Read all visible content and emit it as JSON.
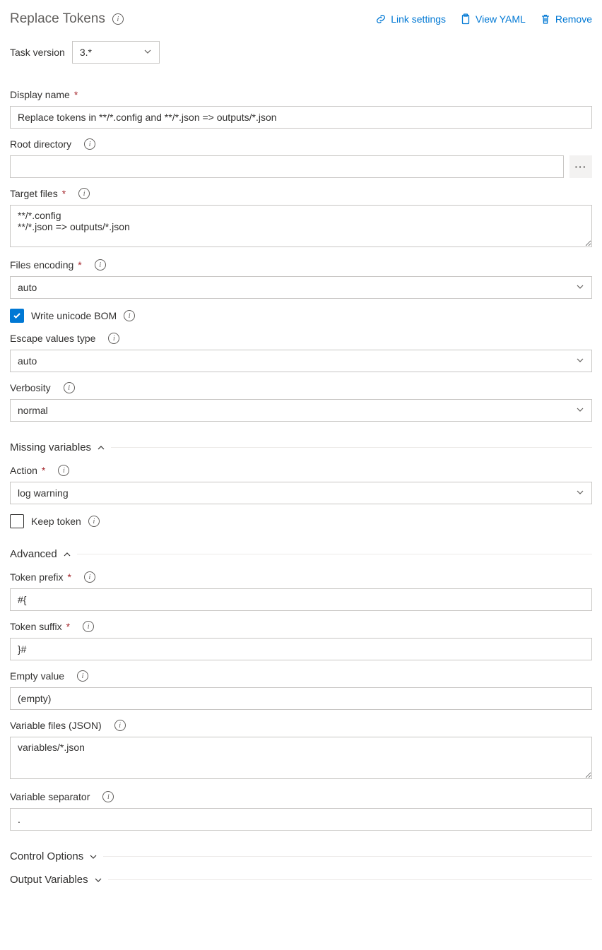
{
  "header": {
    "title": "Replace Tokens",
    "actions": {
      "linkSettings": "Link settings",
      "viewYaml": "View YAML",
      "remove": "Remove"
    }
  },
  "taskVersion": {
    "label": "Task version",
    "value": "3.*"
  },
  "displayName": {
    "label": "Display name",
    "value": "Replace tokens in **/*.config and **/*.json => outputs/*.json"
  },
  "rootDirectory": {
    "label": "Root directory",
    "value": ""
  },
  "targetFiles": {
    "label": "Target files",
    "value": "**/*.config\n**/*.json => outputs/*.json"
  },
  "filesEncoding": {
    "label": "Files encoding",
    "value": "auto"
  },
  "writeBom": {
    "label": "Write unicode BOM",
    "checked": true
  },
  "escapeValues": {
    "label": "Escape values type",
    "value": "auto"
  },
  "verbosity": {
    "label": "Verbosity",
    "value": "normal"
  },
  "sections": {
    "missingVariables": "Missing variables",
    "advanced": "Advanced",
    "controlOptions": "Control Options",
    "outputVariables": "Output Variables"
  },
  "action": {
    "label": "Action",
    "value": "log warning"
  },
  "keepToken": {
    "label": "Keep token",
    "checked": false
  },
  "tokenPrefix": {
    "label": "Token prefix",
    "value": "#{"
  },
  "tokenSuffix": {
    "label": "Token suffix",
    "value": "}#"
  },
  "emptyValue": {
    "label": "Empty value",
    "value": "(empty)"
  },
  "variableFiles": {
    "label": "Variable files (JSON)",
    "value": "variables/*.json"
  },
  "variableSeparator": {
    "label": "Variable separator",
    "value": "."
  }
}
